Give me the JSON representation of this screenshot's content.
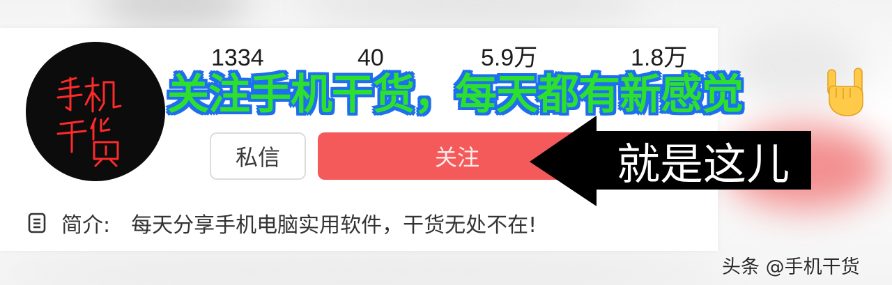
{
  "profile": {
    "avatar_text": "手机干货",
    "stats": [
      "1334",
      "40",
      "5.9万",
      "1.8万"
    ],
    "message_button": "私信",
    "follow_button": "关注",
    "bio_label": "简介:",
    "bio_text": "每天分享手机电脑实用软件，干货无处不在!",
    "bio_icon": "document-icon"
  },
  "overlay": {
    "caption": "关注手机干货，每天都有新感觉",
    "caption_emoji": "🤘",
    "pointer_text": "就是这儿",
    "colors": {
      "caption_fill": "#2ee02e",
      "caption_outline": "#1e6ef0",
      "follow_button": "#f55a5a",
      "avatar_text": "#ff2a2a"
    }
  },
  "watermark": "头条 @手机干货"
}
